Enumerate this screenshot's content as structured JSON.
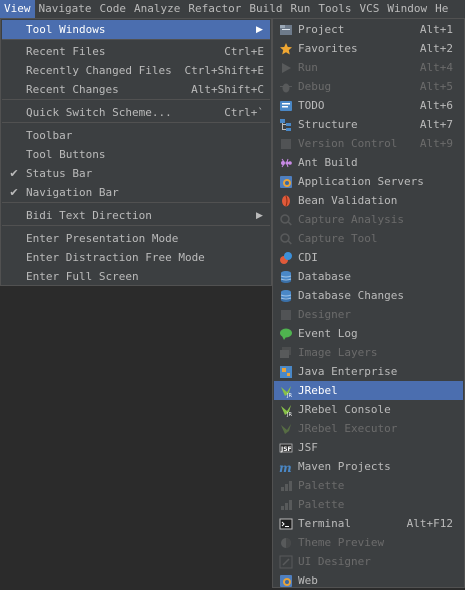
{
  "menubar": {
    "items": [
      "View",
      "Navigate",
      "Code",
      "Analyze",
      "Refactor",
      "Build",
      "Run",
      "Tools",
      "VCS",
      "Window",
      "He"
    ]
  },
  "view_menu": {
    "items": [
      {
        "label": "Tool Windows",
        "shortcut": "",
        "has_submenu": true,
        "checked": false,
        "selected": true
      },
      {
        "label": "Recent Files",
        "shortcut": "Ctrl+E",
        "has_submenu": false,
        "checked": false
      },
      {
        "label": "Recently Changed Files",
        "shortcut": "Ctrl+Shift+E",
        "has_submenu": false,
        "checked": false
      },
      {
        "label": "Recent Changes",
        "shortcut": "Alt+Shift+C",
        "has_submenu": false,
        "checked": false
      },
      {
        "label": "Quick Switch Scheme...",
        "shortcut": "Ctrl+`",
        "has_submenu": false,
        "checked": false
      },
      {
        "label": "Toolbar",
        "shortcut": "",
        "has_submenu": false,
        "checked": false
      },
      {
        "label": "Tool Buttons",
        "shortcut": "",
        "has_submenu": false,
        "checked": false
      },
      {
        "label": "Status Bar",
        "shortcut": "",
        "has_submenu": false,
        "checked": true
      },
      {
        "label": "Navigation Bar",
        "shortcut": "",
        "has_submenu": false,
        "checked": true
      },
      {
        "label": "Bidi Text Direction",
        "shortcut": "",
        "has_submenu": true,
        "checked": false
      },
      {
        "label": "Enter Presentation Mode",
        "shortcut": "",
        "has_submenu": false,
        "checked": false
      },
      {
        "label": "Enter Distraction Free Mode",
        "shortcut": "",
        "has_submenu": false,
        "checked": false
      },
      {
        "label": "Enter Full Screen",
        "shortcut": "",
        "has_submenu": false,
        "checked": false
      }
    ]
  },
  "tool_windows": {
    "items": [
      {
        "label": "Project",
        "shortcut": "Alt+1",
        "icon": "project-icon",
        "enabled": true
      },
      {
        "label": "Favorites",
        "shortcut": "Alt+2",
        "icon": "star-icon",
        "enabled": true
      },
      {
        "label": "Run",
        "shortcut": "Alt+4",
        "icon": "run-icon",
        "enabled": false
      },
      {
        "label": "Debug",
        "shortcut": "Alt+5",
        "icon": "debug-icon",
        "enabled": false
      },
      {
        "label": "TODO",
        "shortcut": "Alt+6",
        "icon": "todo-icon",
        "enabled": true
      },
      {
        "label": "Structure",
        "shortcut": "Alt+7",
        "icon": "structure-icon",
        "enabled": true
      },
      {
        "label": "Version Control",
        "shortcut": "Alt+9",
        "icon": "version-control-icon",
        "enabled": false
      },
      {
        "label": "Ant Build",
        "shortcut": "",
        "icon": "ant-icon",
        "enabled": true
      },
      {
        "label": "Application Servers",
        "shortcut": "",
        "icon": "app-servers-icon",
        "enabled": true
      },
      {
        "label": "Bean Validation",
        "shortcut": "",
        "icon": "bean-icon",
        "enabled": true
      },
      {
        "label": "Capture Analysis",
        "shortcut": "",
        "icon": "capture-analysis-icon",
        "enabled": false
      },
      {
        "label": "Capture Tool",
        "shortcut": "",
        "icon": "capture-tool-icon",
        "enabled": false
      },
      {
        "label": "CDI",
        "shortcut": "",
        "icon": "cdi-icon",
        "enabled": true
      },
      {
        "label": "Database",
        "shortcut": "",
        "icon": "database-icon",
        "enabled": true
      },
      {
        "label": "Database Changes",
        "shortcut": "",
        "icon": "database-changes-icon",
        "enabled": true
      },
      {
        "label": "Designer",
        "shortcut": "",
        "icon": "designer-icon",
        "enabled": false
      },
      {
        "label": "Event Log",
        "shortcut": "",
        "icon": "event-log-icon",
        "enabled": true
      },
      {
        "label": "Image Layers",
        "shortcut": "",
        "icon": "image-layers-icon",
        "enabled": false
      },
      {
        "label": "Java Enterprise",
        "shortcut": "",
        "icon": "java-enterprise-icon",
        "enabled": true
      },
      {
        "label": "JRebel",
        "shortcut": "",
        "icon": "jrebel-icon",
        "enabled": true,
        "selected": true
      },
      {
        "label": "JRebel Console",
        "shortcut": "",
        "icon": "jrebel-console-icon",
        "enabled": true
      },
      {
        "label": "JRebel Executor",
        "shortcut": "",
        "icon": "jrebel-executor-icon",
        "enabled": false
      },
      {
        "label": "JSF",
        "shortcut": "",
        "icon": "jsf-icon",
        "enabled": true
      },
      {
        "label": "Maven Projects",
        "shortcut": "",
        "icon": "maven-icon",
        "enabled": true
      },
      {
        "label": "Palette",
        "shortcut": "",
        "icon": "palette-icon",
        "enabled": false
      },
      {
        "label": "Palette",
        "shortcut": "",
        "icon": "palette-icon",
        "enabled": false
      },
      {
        "label": "Terminal",
        "shortcut": "Alt+F12",
        "icon": "terminal-icon",
        "enabled": true
      },
      {
        "label": "Theme Preview",
        "shortcut": "",
        "icon": "theme-preview-icon",
        "enabled": false
      },
      {
        "label": "UI Designer",
        "shortcut": "",
        "icon": "ui-designer-icon",
        "enabled": false
      },
      {
        "label": "Web",
        "shortcut": "",
        "icon": "web-icon",
        "enabled": true
      }
    ]
  },
  "colors": {
    "background": "#2b2b2b",
    "menu": "#3c3f41",
    "selection": "#4b6eaf",
    "text": "#bbbbbb",
    "disabled": "#6b6b6b"
  }
}
